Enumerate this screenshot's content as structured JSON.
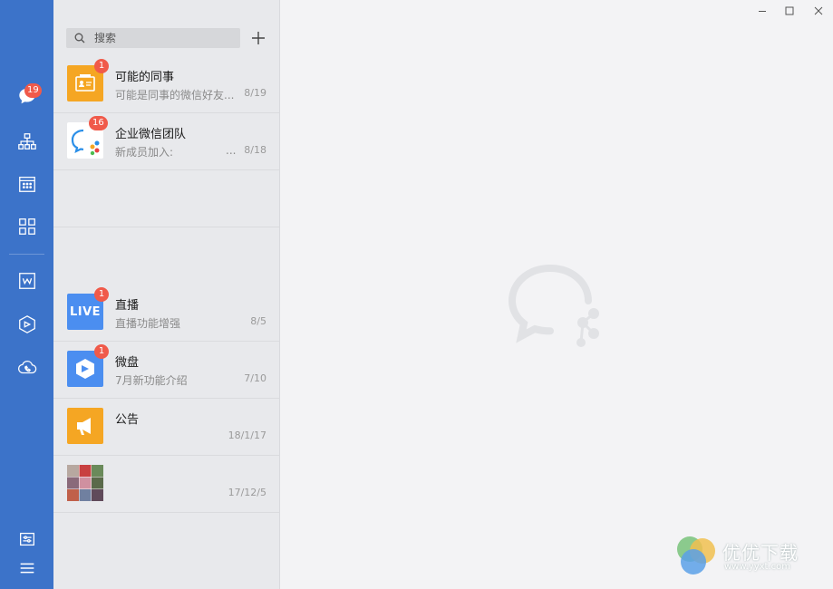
{
  "sidebar": {
    "message_badge": "19",
    "items": [
      {
        "name": "messages-icon"
      },
      {
        "name": "contacts-org-icon"
      },
      {
        "name": "calendar-icon"
      },
      {
        "name": "apps-grid-icon"
      },
      {
        "name": "doc-w-icon"
      },
      {
        "name": "weipan-cube-icon"
      },
      {
        "name": "cloud-phone-icon"
      }
    ],
    "bottom": [
      {
        "name": "settings-sliders-icon"
      },
      {
        "name": "menu-icon"
      }
    ]
  },
  "search": {
    "placeholder": "搜索"
  },
  "conversations": [
    {
      "title": "可能的同事",
      "preview": "可能是同事的微信好友...",
      "time": "8/19",
      "badge": "1",
      "avatar": "contact-card-icon",
      "color": "#f5a623"
    },
    {
      "title": "企业微信团队",
      "preview": "新成员加入:",
      "ellipsis": "...",
      "time": "8/18",
      "badge": "16",
      "avatar": "wecom-logo-icon",
      "color": "#ffffff"
    },
    {
      "title": "直播",
      "preview": "直播功能增强",
      "time": "8/5",
      "badge": "1",
      "avatar": "live-icon",
      "avatar_text": "LIVE",
      "color": "#4b8ef0"
    },
    {
      "title": "微盘",
      "preview": "7月新功能介绍",
      "time": "7/10",
      "badge": "1",
      "avatar": "weipan-icon",
      "color": "#4b8ef0"
    },
    {
      "title": "公告",
      "preview": "",
      "time": "18/1/17",
      "avatar": "megaphone-icon",
      "color": "#f5a623"
    },
    {
      "title": "",
      "preview": "",
      "time": "17/12/5",
      "avatar": "group-photo-icon",
      "color": "#888888"
    }
  ],
  "watermark": {
    "text": "优优下载",
    "url": "www.yyxt.com"
  }
}
